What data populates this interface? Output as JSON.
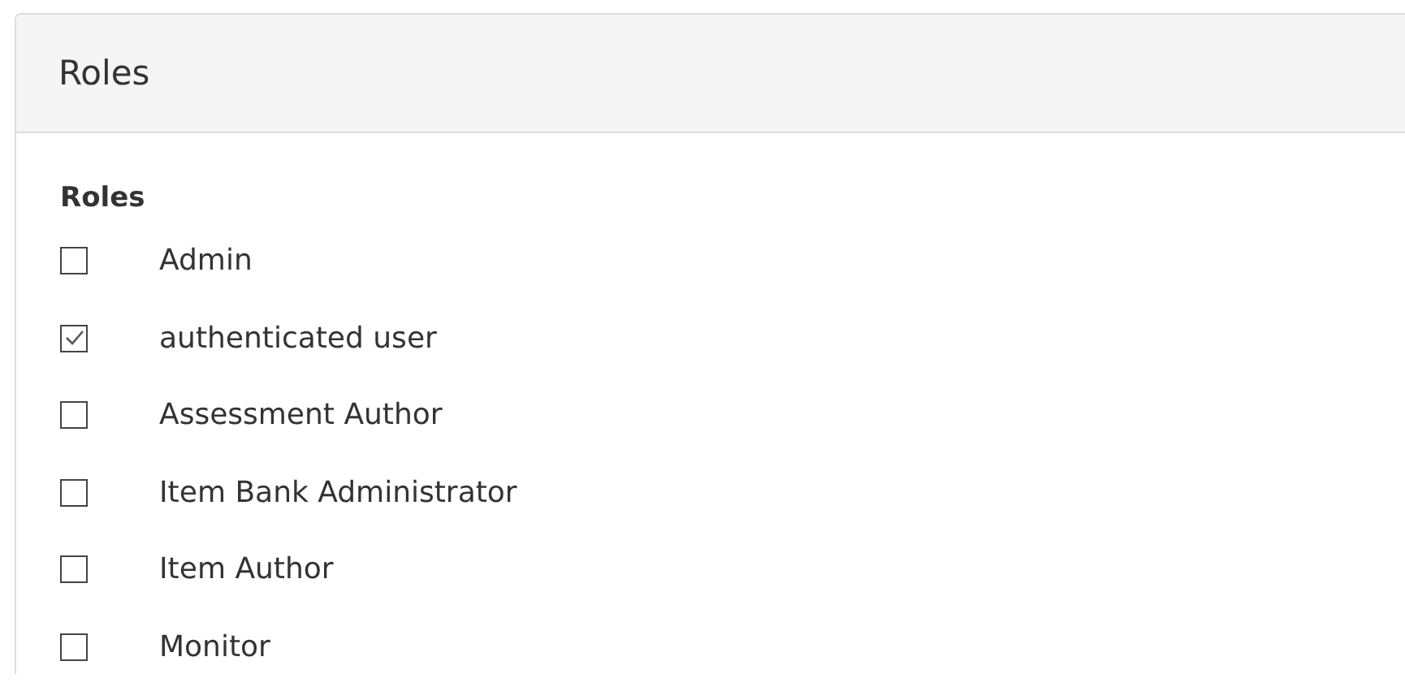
{
  "panel": {
    "title": "Roles"
  },
  "group": {
    "label": "Roles"
  },
  "roles": [
    {
      "label": "Admin",
      "checked": false
    },
    {
      "label": "authenticated user",
      "checked": true
    },
    {
      "label": "Assessment Author",
      "checked": false
    },
    {
      "label": "Item Bank Administrator",
      "checked": false
    },
    {
      "label": "Item Author",
      "checked": false
    },
    {
      "label": "Monitor",
      "checked": false
    }
  ]
}
